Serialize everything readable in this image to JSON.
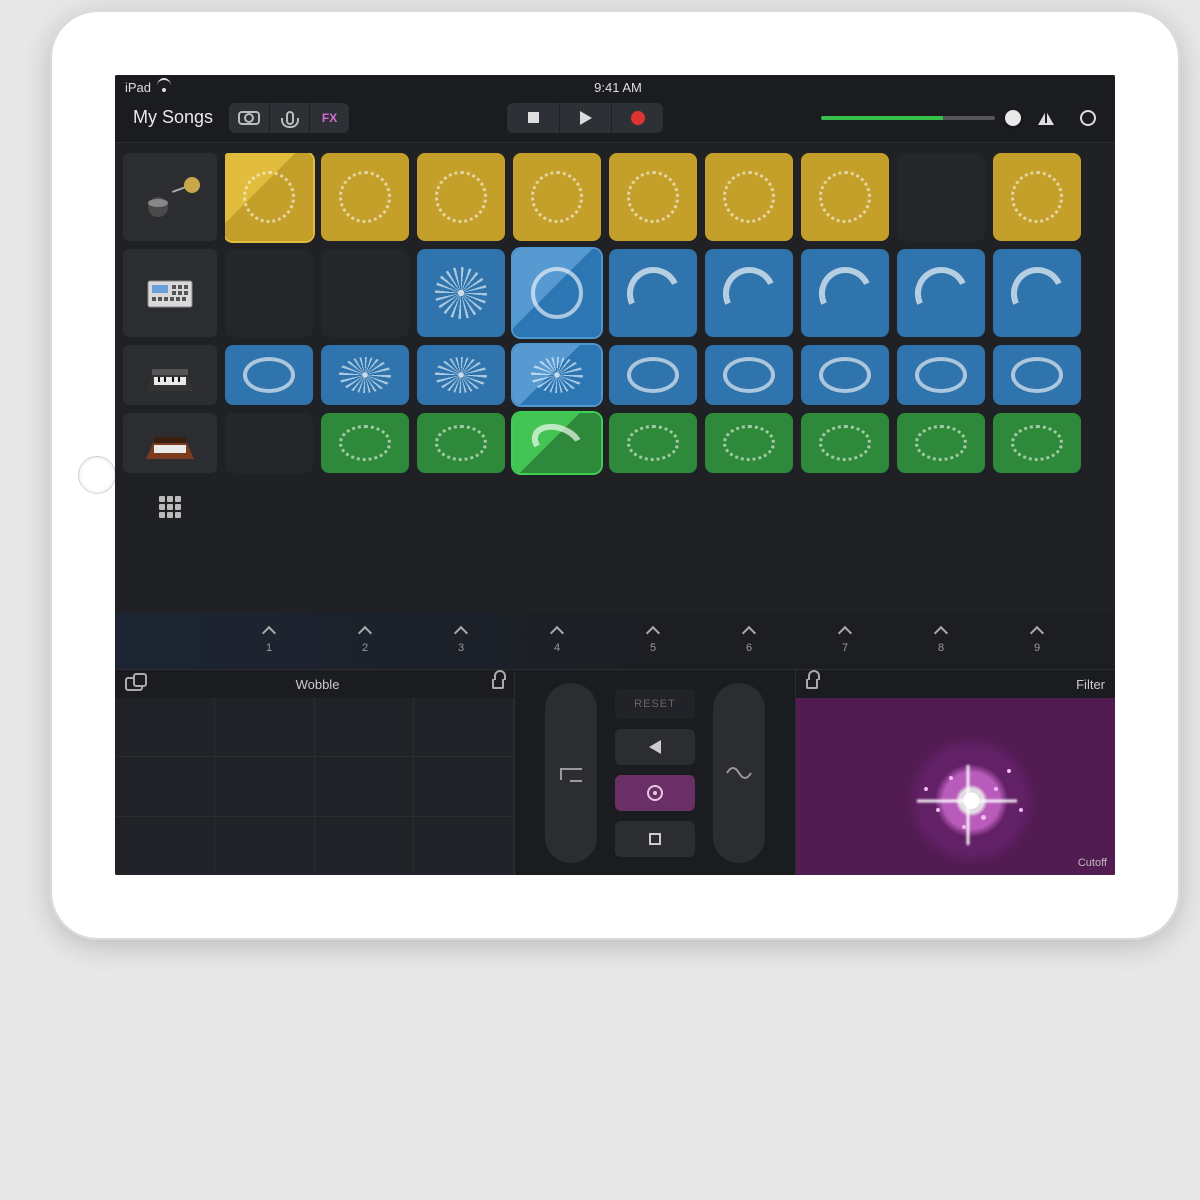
{
  "statusbar": {
    "device": "iPad",
    "time": "9:41 AM"
  },
  "toolbar": {
    "back_label": "My Songs",
    "fx_label": "FX",
    "metronome": "metronome",
    "info": "info"
  },
  "tracks": [
    {
      "name": "drums"
    },
    {
      "name": "sampler"
    },
    {
      "name": "keys"
    },
    {
      "name": "synth"
    }
  ],
  "grid": {
    "rows": [
      {
        "color": "y",
        "active": 0,
        "cells": [
          "dot",
          "dot",
          "dot",
          "dot",
          "dot",
          "dot",
          "dot",
          "d",
          "dot"
        ]
      },
      {
        "color": "b",
        "active": 3,
        "cells": [
          "d",
          "d",
          "burst",
          "solid",
          "seg",
          "seg",
          "seg",
          "seg",
          "seg"
        ]
      },
      {
        "color": "b",
        "active": 3,
        "cells": [
          "solid",
          "burst",
          "burst",
          "burst",
          "solid",
          "solid",
          "solid",
          "solid",
          "solid"
        ],
        "small": true
      },
      {
        "color": "g",
        "active": 3,
        "cells": [
          "d",
          "dot",
          "dot",
          "seg",
          "dot",
          "dot",
          "dot",
          "dot",
          "dot"
        ],
        "small": true
      }
    ]
  },
  "triggers": [
    "1",
    "2",
    "3",
    "4",
    "5",
    "6",
    "7",
    "8",
    "9"
  ],
  "fx": {
    "left_name": "Wobble",
    "reset_label": "RESET",
    "right_name": "Filter",
    "right_axis": "Cutoff"
  }
}
